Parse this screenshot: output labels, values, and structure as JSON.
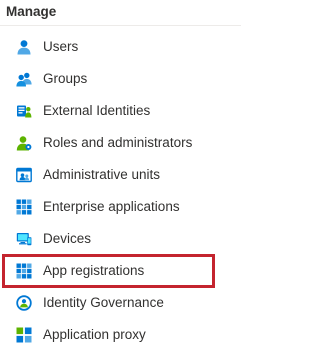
{
  "section": {
    "header": "Manage"
  },
  "menu": {
    "items": [
      {
        "label": "Users",
        "icon": "user-icon"
      },
      {
        "label": "Groups",
        "icon": "groups-icon"
      },
      {
        "label": "External Identities",
        "icon": "external-identities-icon"
      },
      {
        "label": "Roles and administrators",
        "icon": "roles-administrators-icon"
      },
      {
        "label": "Administrative units",
        "icon": "administrative-units-icon"
      },
      {
        "label": "Enterprise applications",
        "icon": "enterprise-applications-icon"
      },
      {
        "label": "Devices",
        "icon": "devices-icon"
      },
      {
        "label": "App registrations",
        "icon": "app-registrations-icon"
      },
      {
        "label": "Identity Governance",
        "icon": "identity-governance-icon"
      },
      {
        "label": "Application proxy",
        "icon": "application-proxy-icon"
      }
    ],
    "highlighted_item": "App registrations"
  },
  "colors": {
    "text": "#323130",
    "highlight_border": "#c4242e",
    "icon_blue": "#0078d4",
    "icon_light_blue": "#50e6ff",
    "icon_green": "#5db300"
  }
}
